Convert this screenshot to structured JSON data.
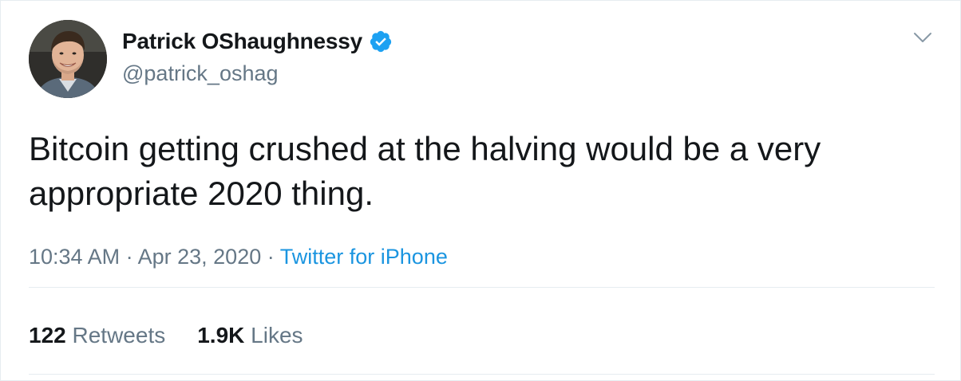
{
  "author": {
    "display_name": "Patrick OShaughnessy",
    "handle": "@patrick_oshag",
    "verified": true
  },
  "tweet": {
    "text": "Bitcoin getting crushed at the halving would be a very appropriate 2020 thing.",
    "time": "10:34 AM",
    "date": "Apr 23, 2020",
    "source": "Twitter for iPhone",
    "separator": "·"
  },
  "stats": {
    "retweets_count": "122",
    "retweets_label": "Retweets",
    "likes_count": "1.9K",
    "likes_label": "Likes"
  },
  "icons": {
    "verified": "verified-badge-icon",
    "menu": "chevron-down-icon"
  },
  "colors": {
    "text_primary": "#14171a",
    "text_secondary": "#657786",
    "link": "#1b95e0",
    "verified": "#1da1f2",
    "divider": "#e6ecf0"
  }
}
